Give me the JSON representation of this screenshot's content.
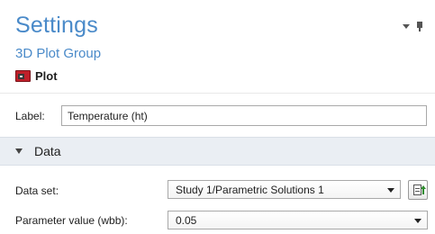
{
  "header": {
    "title": "Settings",
    "subtitle": "3D Plot Group",
    "plot_button_label": "Plot"
  },
  "label_field": {
    "label": "Label:",
    "value": "Temperature (ht)"
  },
  "data_section": {
    "title": "Data",
    "dataset": {
      "label": "Data set:",
      "selected": "Study 1/Parametric Solutions 1"
    },
    "parameter": {
      "label": "Parameter value (wbb):",
      "selected": "0.05"
    }
  },
  "colors": {
    "accent": "#4a8ac9",
    "section_bg": "#eaeef3",
    "plot_icon": "#c0202a"
  },
  "icons": {
    "menu": "chevron-down-icon",
    "pin": "pin-icon",
    "plot": "plot-icon",
    "section_toggle": "section-collapse-icon",
    "goto_source": "goto-source-icon"
  }
}
